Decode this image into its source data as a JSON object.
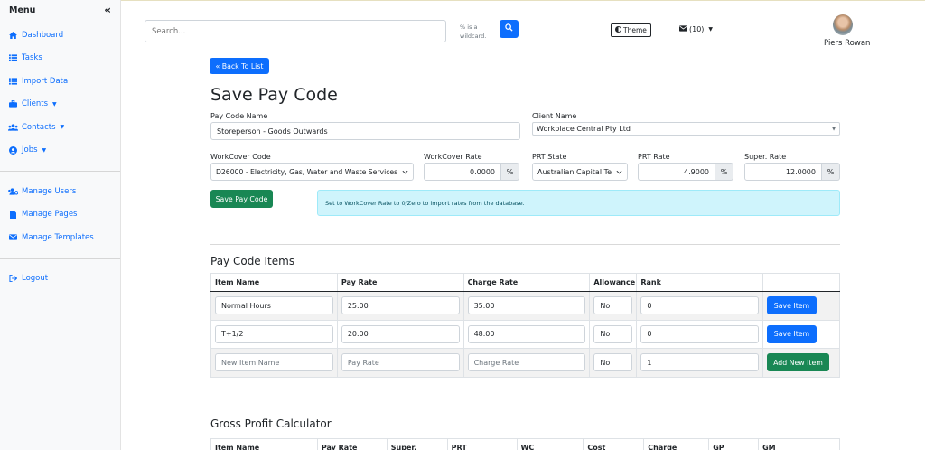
{
  "sidebar": {
    "title": "Menu",
    "collapse_icon": "«",
    "items": [
      {
        "label": "Dashboard",
        "icon": "home-icon"
      },
      {
        "label": "Tasks",
        "icon": "list-icon"
      },
      {
        "label": "Import Data",
        "icon": "list-icon"
      },
      {
        "label": "Clients",
        "icon": "briefcase-icon",
        "dropdown": true
      },
      {
        "label": "Contacts",
        "icon": "users-icon",
        "dropdown": true
      },
      {
        "label": "Jobs",
        "icon": "user-circle-icon",
        "dropdown": true
      }
    ],
    "admin_items": [
      {
        "label": "Manage Users",
        "icon": "users-cog-icon"
      },
      {
        "label": "Manage Pages",
        "icon": "file-icon"
      },
      {
        "label": "Manage Templates",
        "icon": "envelope-icon"
      }
    ],
    "logout": {
      "label": "Logout",
      "icon": "sign-out-icon"
    }
  },
  "topbar": {
    "search_placeholder": "Search...",
    "search_hint": "% is a wildcard.",
    "theme_label": "Theme",
    "mail_label": "(10)",
    "user_name": "Piers Rowan"
  },
  "page": {
    "back_label": "« Back To List",
    "title": "Save Pay Code",
    "pay_code_name_label": "Pay Code Name",
    "pay_code_name_value": "Storeperson - Goods Outwards",
    "client_name_label": "Client Name",
    "client_name_value": "Workplace Central Pty Ltd",
    "workcover_code_label": "WorkCover Code",
    "workcover_code_value": "D26000 - Electricity, Gas, Water and Waste Services",
    "workcover_rate_label": "WorkCover Rate",
    "workcover_rate_value": "0.0000",
    "prt_state_label": "PRT State",
    "prt_state_value": "Australian Capital Te",
    "prt_rate_label": "PRT Rate",
    "prt_rate_value": "4.9000",
    "super_rate_label": "Super. Rate",
    "super_rate_value": "12.0000",
    "percent": "%",
    "save_label": "Save Pay Code",
    "info": "Set to WorkCover Rate to 0/Zero to import rates from the database."
  },
  "items": {
    "heading": "Pay Code Items",
    "columns": [
      "Item Name",
      "Pay Rate",
      "Charge Rate",
      "Allowance",
      "Rank"
    ],
    "rows": [
      {
        "name": "Normal Hours",
        "pay": "25.00",
        "charge": "35.00",
        "allowance": "No",
        "rank": "0",
        "action": "Save Item"
      },
      {
        "name": "T+1/2",
        "pay": "20.00",
        "charge": "48.00",
        "allowance": "No",
        "rank": "0",
        "action": "Save Item"
      }
    ],
    "new_row": {
      "name_ph": "New Item Name",
      "pay_ph": "Pay Rate",
      "charge_ph": "Charge Rate",
      "allowance": "No",
      "rank": "1",
      "action": "Add New Item"
    }
  },
  "gp": {
    "heading": "Gross Profit Calculator",
    "columns": [
      "Item Name",
      "Pay Rate",
      "Super.",
      "PRT",
      "WC",
      "Cost",
      "Charge",
      "GP",
      "GM"
    ]
  },
  "colors": {
    "primary": "#0d6efd",
    "success": "#198754",
    "info_bg": "#cff4fc"
  }
}
